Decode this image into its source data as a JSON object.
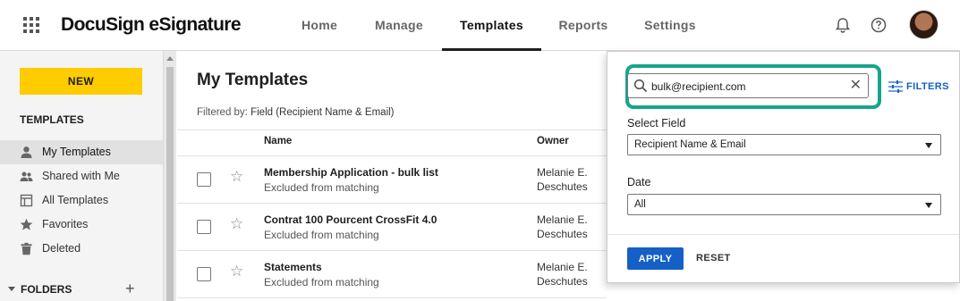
{
  "header": {
    "brand": "DocuSign eSignature",
    "tabs": [
      {
        "label": "Home"
      },
      {
        "label": "Manage"
      },
      {
        "label": "Templates"
      },
      {
        "label": "Reports"
      },
      {
        "label": "Settings"
      }
    ],
    "active_tab": "Templates",
    "icons": [
      "apps-grid-icon",
      "bell-icon",
      "help-icon",
      "avatar"
    ]
  },
  "sidebar": {
    "new_label": "NEW",
    "section_heading": "TEMPLATES",
    "items": [
      {
        "label": "My Templates",
        "icon": "person-icon",
        "active": true
      },
      {
        "label": "Shared with Me",
        "icon": "people-icon"
      },
      {
        "label": "All Templates",
        "icon": "template-icon"
      },
      {
        "label": "Favorites",
        "icon": "star-icon"
      },
      {
        "label": "Deleted",
        "icon": "trash-icon"
      }
    ],
    "folders_label": "FOLDERS"
  },
  "main": {
    "title": "My Templates",
    "filtered_by_label": "Filtered by:",
    "filtered_by_value": "Field (Recipient Name & Email)",
    "columns": [
      "Name",
      "Owner"
    ],
    "rows": [
      {
        "name": "Membership Application - bulk list",
        "status": "Excluded from matching",
        "owner_first": "Melanie E.",
        "owner_last": "Deschutes"
      },
      {
        "name": "Contrat 100 Pourcent CrossFit 4.0",
        "status": "Excluded from matching",
        "owner_first": "Melanie E.",
        "owner_last": "Deschutes"
      },
      {
        "name": "Statements",
        "status": "Excluded from matching",
        "owner_first": "Melanie E.",
        "owner_last": "Deschutes"
      }
    ]
  },
  "filter_panel": {
    "search_value": "bulk@recipient.com",
    "filters_label": "FILTERS",
    "select_field_label": "Select Field",
    "select_field_value": "Recipient Name & Email",
    "date_label": "Date",
    "date_value": "All",
    "apply_label": "APPLY",
    "reset_label": "RESET",
    "highlight_color": "#17a589"
  },
  "colors": {
    "brand_yellow": "#ffcc00",
    "primary_blue": "#1560c6",
    "highlight_green": "#17a589"
  }
}
